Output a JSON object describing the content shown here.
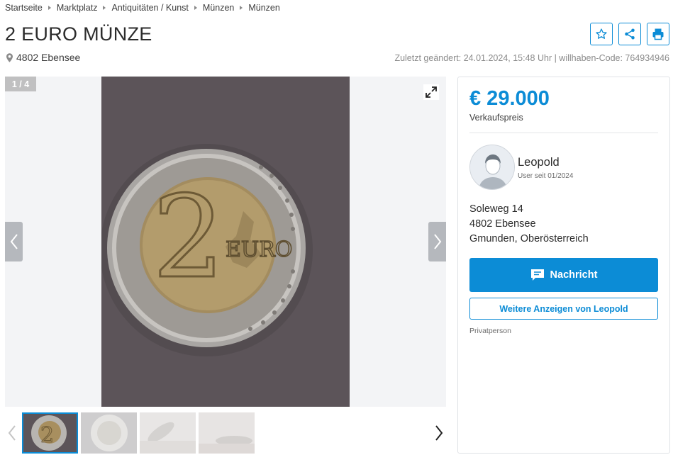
{
  "breadcrumb": [
    "Startseite",
    "Marktplatz",
    "Antiquitäten / Kunst",
    "Münzen",
    "Münzen"
  ],
  "title": "2 EURO MÜNZE",
  "location": "4802 Ebensee",
  "meta": "Zuletzt geändert: 24.01.2024, 15:48 Uhr | willhaben-Code: 764934946",
  "gallery": {
    "counter": "1 / 4",
    "coin_numeral": "2",
    "coin_word": "EURO"
  },
  "price": {
    "value": "€ 29.000",
    "label": "Verkaufspreis"
  },
  "seller": {
    "name": "Leopold",
    "since": "User seit 01/2024",
    "address": [
      "Soleweg 14",
      "4802 Ebensee",
      "Gmunden, Oberösterreich"
    ],
    "type": "Privatperson"
  },
  "buttons": {
    "message": "Nachricht",
    "more_ads": "Weitere Anzeigen von Leopold"
  },
  "icons": [
    "star-icon",
    "share-icon",
    "print-icon",
    "location-pin-icon",
    "expand-icon",
    "chevron-left-icon",
    "chevron-right-icon",
    "chat-icon"
  ],
  "colors": {
    "accent": "#0c8cd6",
    "price": "#0c8cd6"
  }
}
